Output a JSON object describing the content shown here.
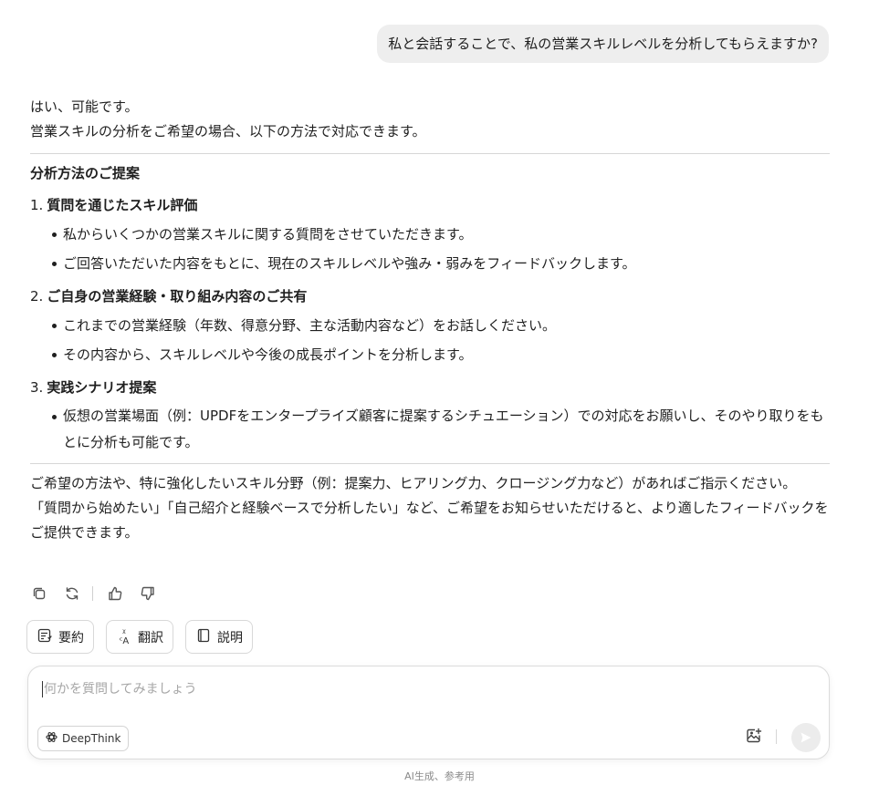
{
  "user_message": "私と会話することで、私の営業スキルレベルを分析してもらえますか?",
  "answer": {
    "intro": [
      "はい、可能です。",
      "営業スキルの分析をご希望の場合、以下の方法で対応できます。"
    ],
    "section_title": "分析方法のご提案",
    "methods": [
      {
        "num": "1.",
        "title": "質問を通じたスキル評価",
        "bullets": [
          "私からいくつかの営業スキルに関する質問をさせていただきます。",
          "ご回答いただいた内容をもとに、現在のスキルレベルや強み・弱みをフィードバックします。"
        ]
      },
      {
        "num": "2.",
        "title": "ご自身の営業経験・取り組み内容のご共有",
        "bullets": [
          "これまでの営業経験（年数、得意分野、主な活動内容など）をお話しください。",
          "その内容から、スキルレベルや今後の成長ポイントを分析します。"
        ]
      },
      {
        "num": "3.",
        "title": "実践シナリオ提案",
        "bullets": [
          "仮想の営業場面（例：UPDFをエンタープライズ顧客に提案するシチュエーション）での対応をお願いし、そのやり取りをもとに分析も可能です。"
        ]
      }
    ],
    "closing": [
      "ご希望の方法や、特に強化したいスキル分野（例：提案力、ヒアリング力、クロージング力など）があればご指示ください。",
      "「質問から始めたい」「自己紹介と経験ベースで分析したい」など、ご希望をお知らせいただけると、より適したフィードバックをご提供できます。"
    ]
  },
  "action_icons": [
    "copy-icon",
    "regenerate-icon",
    "thumbs-up-icon",
    "thumbs-down-icon"
  ],
  "chips": [
    {
      "label": "要約",
      "icon": "summary-icon"
    },
    {
      "label": "翻訳",
      "icon": "translate-icon"
    },
    {
      "label": "説明",
      "icon": "book-icon"
    }
  ],
  "composer": {
    "placeholder": "何かを質問してみましょう",
    "deepthink_label": "DeepThink"
  },
  "footer_note": "AI生成、参考用"
}
